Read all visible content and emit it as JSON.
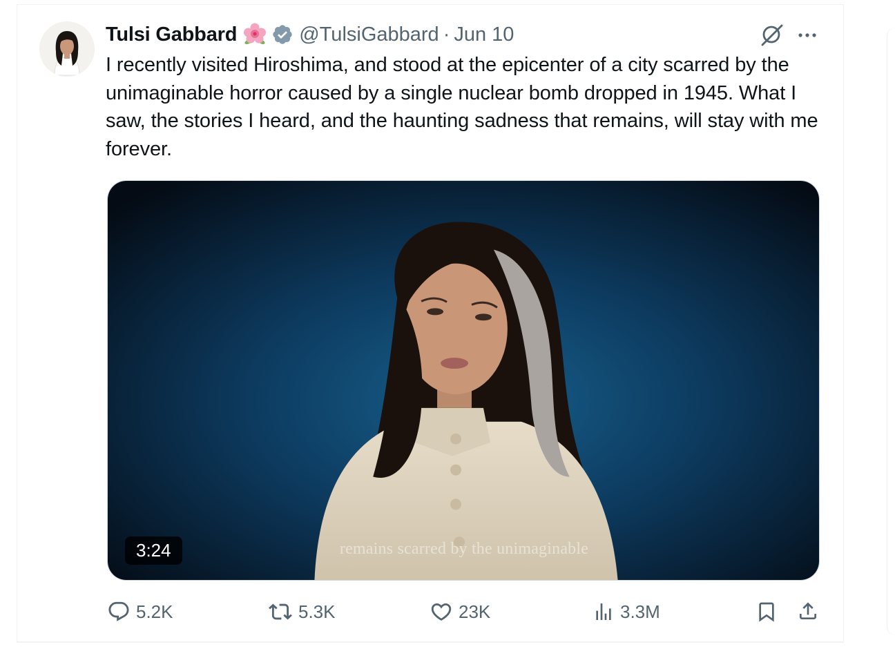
{
  "tweet": {
    "display_name": "Tulsi Gabbard",
    "emoji": "🌺",
    "handle": "@TulsiGabbard",
    "separator": "·",
    "date": "Jun 10",
    "text": "I recently visited Hiroshima, and stood at the epicenter of a city scarred by the unimaginable horror caused by a single nuclear bomb dropped in 1945. What I saw, the stories I heard, and the haunting sadness that remains, will stay with me forever."
  },
  "media": {
    "duration": "3:24",
    "caption": "remains scarred by the unimaginable"
  },
  "actions": {
    "replies": "5.2K",
    "reposts": "5.3K",
    "likes": "23K",
    "views": "3.3M"
  },
  "icons": [
    "grok-icon",
    "more-icon",
    "verified-icon",
    "reply-icon",
    "repost-icon",
    "like-icon",
    "views-icon",
    "bookmark-icon",
    "share-icon"
  ],
  "colors": {
    "verified": "#829aab",
    "text_primary": "#0f1419",
    "text_secondary": "#536471",
    "media_background": "#0e3a5c"
  }
}
